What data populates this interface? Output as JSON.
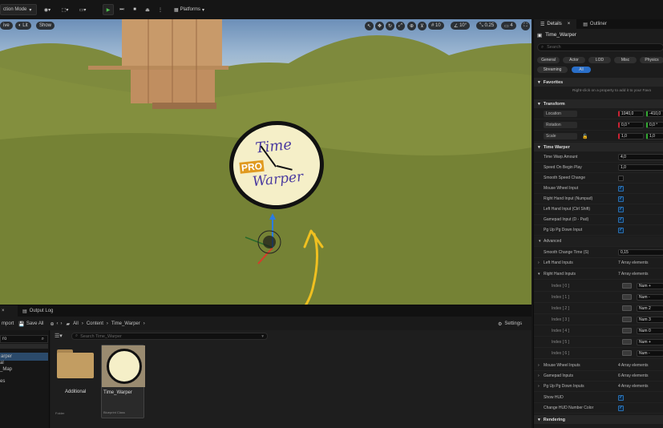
{
  "toolbar": {
    "mode_label": "ction Mode",
    "platforms_label": "Platforms"
  },
  "viewport": {
    "perspective_label": "ive",
    "lit_label": "Lit",
    "show_label": "Show",
    "grid_snap_value": "10",
    "rotation_snap_value": "10°",
    "scale_snap_value": "0.25",
    "camera_speed_value": "4"
  },
  "details": {
    "tab_details": "Details",
    "tab_outliner": "Outliner",
    "actor_name": "Time_Warper",
    "search_placeholder": "Search",
    "filters": [
      "General",
      "Actor",
      "LOD",
      "Misc",
      "Physics",
      "Streaming",
      "All"
    ],
    "favorites_label": "Favorites",
    "favorites_hint": "Right-click on a property to add it to your Favo",
    "transform_label": "Transform",
    "location_label": "Location",
    "location_x": "1040,0",
    "location_y": "-410,0",
    "rotation_label": "Rotation",
    "rotation_x": "0,0 °",
    "rotation_y": "0,0 °",
    "scale_label": "Scale",
    "scale_x": "1,0",
    "scale_y": "1,0",
    "time_warper_label": "Time Warper",
    "time_warp_amount_label": "Time Warp Amount",
    "time_warp_amount": "4,0",
    "speed_on_begin_play_label": "Speed On Begin Play",
    "speed_on_begin_play": "1,0",
    "smooth_speed_change_label": "Smooth Speed Change",
    "mouse_wheel_input_label": "Mouse Wheel Input",
    "right_hand_input_label": "Right Hand Input (Numpad)",
    "left_hand_input_label": "Left Hand Input (Ctrl Shift)",
    "gamepad_input_label": "Gamepad Input (D - Pad)",
    "pg_up_pg_down_label": "Pg Up Pg Down Input",
    "advanced_label": "Advanced",
    "smooth_change_time_label": "Smooth Change Time (S)",
    "smooth_change_time": "0,15",
    "left_hand_inputs_label": "Left Hand Inputs",
    "left_hand_inputs_count": "7 Array elements",
    "right_hand_inputs_label": "Right Hand Inputs",
    "right_hand_inputs_count": "7 Array elements",
    "index_rows": [
      {
        "label": "Index [ 0 ]",
        "value": "Num +"
      },
      {
        "label": "Index [ 1 ]",
        "value": "Num -"
      },
      {
        "label": "Index [ 2 ]",
        "value": "Num 2"
      },
      {
        "label": "Index [ 3 ]",
        "value": "Num 3"
      },
      {
        "label": "Index [ 4 ]",
        "value": "Num 0"
      },
      {
        "label": "Index [ 5 ]",
        "value": "Num +"
      },
      {
        "label": "Index [ 6 ]",
        "value": "Num -"
      }
    ],
    "mouse_wheel_inputs_label": "Mouse Wheel Inputs",
    "mouse_wheel_inputs_count": "4 Array elements",
    "gamepad_inputs_label": "Gamepad Inputs",
    "gamepad_inputs_count": "6 Array elements",
    "pg_up_pg_down_inputs_label": "Pg Up Pg Down Inputs",
    "pg_up_pg_down_inputs_count": "4 Array elements",
    "show_hud_label": "Show HUD",
    "change_hud_color_label": "Change HUD Number Color",
    "rendering_label": "Rendering"
  },
  "content_browser": {
    "tab_output_log": "Output Log",
    "import_label": "mport",
    "save_all_label": "Save All",
    "path": [
      "All",
      "Content",
      "Time_Warper"
    ],
    "settings_label": "Settings",
    "search_placeholder": "Search Time_Warper",
    "left_search_value": "ro",
    "tree_items": [
      "arper",
      "al",
      "_Map",
      "es"
    ],
    "assets": [
      {
        "name": "Additional",
        "type": "Folder"
      },
      {
        "name": "Time_Warper",
        "type": "Blueprint Class"
      }
    ]
  },
  "clock": {
    "line1": "Time",
    "line2": "PRO",
    "line3": "Warper"
  }
}
